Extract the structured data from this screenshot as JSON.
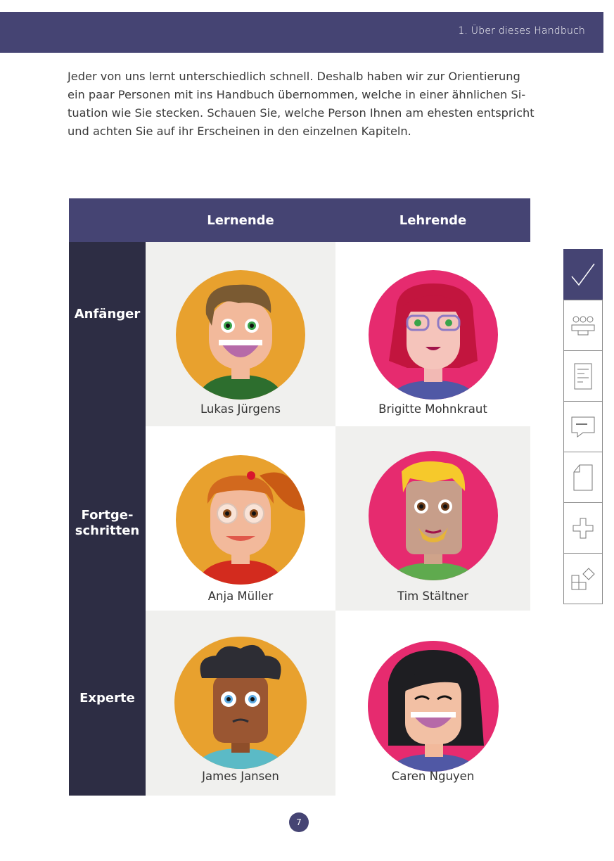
{
  "header": {
    "title": "1. Über dieses Handbuch"
  },
  "intro": {
    "lines": [
      "Jeder von uns lernt unterschiedlich schnell. Deshalb haben wir zur Orientierung",
      "ein paar Personen mit ins Handbuch übernommen, welche in einer ähnlichen Si-",
      "tuation wie Sie stecken. Schauen Sie, welche Person Ihnen am ehesten entspricht",
      "und achten Sie auf ihr Erscheinen in den einzelnen Kapiteln."
    ]
  },
  "grid": {
    "columns": [
      "Lernende",
      "Lehrende"
    ],
    "rows": [
      {
        "label_lines": [
          "Anfänger"
        ]
      },
      {
        "label_lines": [
          "Fortge-",
          "schritten"
        ]
      },
      {
        "label_lines": [
          "Experte"
        ]
      }
    ],
    "people": [
      [
        "Lukas Jürgens",
        "Brigitte Mohnkraut"
      ],
      [
        "Anja Müller",
        "Tim Stältner"
      ],
      [
        "James Jansen",
        "Caren Nguyen"
      ]
    ]
  },
  "sidebar": {
    "icons": [
      "checkmark-icon",
      "group-icon",
      "document-icon",
      "comment-icon",
      "page-icon",
      "plus-icon",
      "shapes-icon"
    ]
  },
  "footer": {
    "page_number": "7"
  },
  "colors": {
    "primary": "#454473",
    "dark": "#2d2d44",
    "orange": "#e8a12e",
    "pink": "#e62b6f"
  }
}
